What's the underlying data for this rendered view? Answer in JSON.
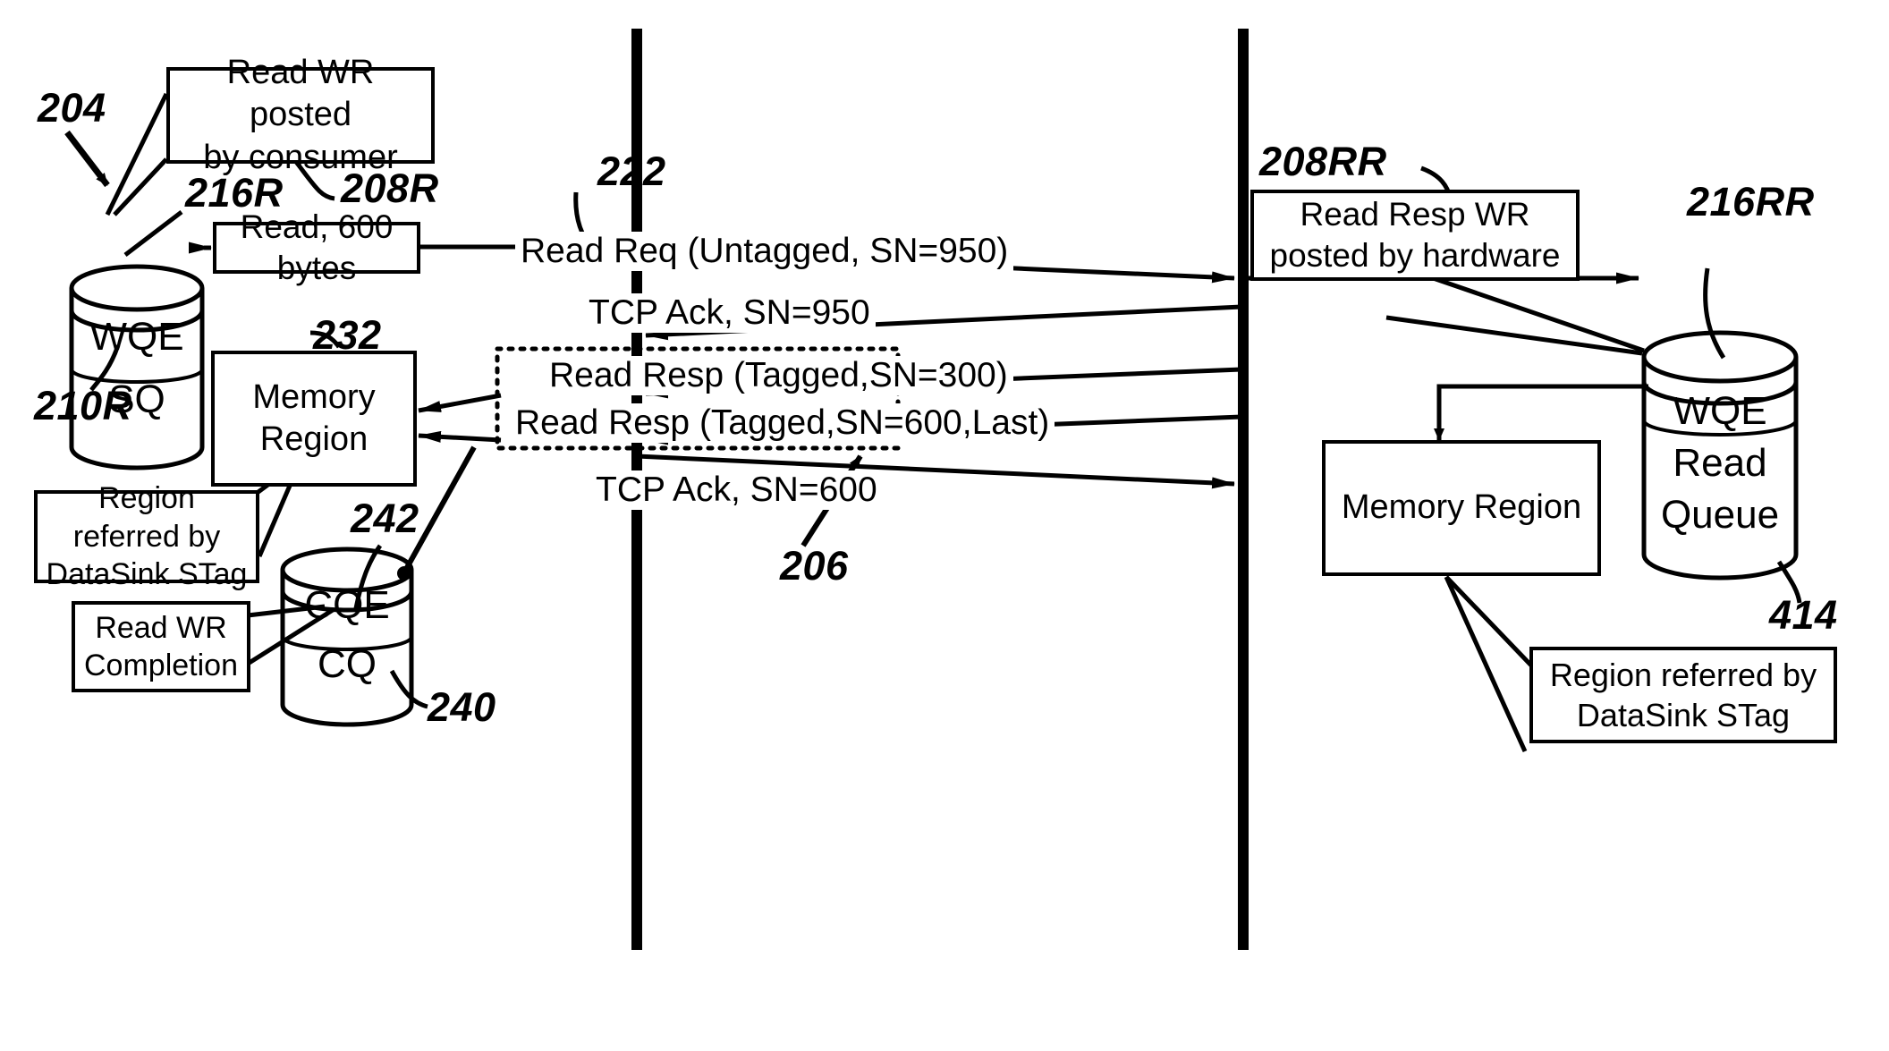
{
  "figure": {
    "type": "rdma-read-operation-sequence-diagram",
    "domain": "patent-figure"
  },
  "reference_numerals": {
    "n204": "204",
    "n216R": "216R",
    "n208R": "208R",
    "n210R": "210R",
    "n232": "232",
    "n242": "242",
    "n240": "240",
    "n222": "222",
    "n206": "206",
    "n208RR": "208RR",
    "n216RR": "216RR",
    "n414": "414"
  },
  "left_side": {
    "sq_cylinder": {
      "top_label": "WQE",
      "bottom_label": "SQ"
    },
    "callout_read_wr": {
      "line1": "Read WR posted",
      "line2": "by consumer"
    },
    "read_op_box": "Read, 600 bytes",
    "memory_region_box": "Memory Region",
    "region_stag_callout": {
      "line1": "Region referred by",
      "line2": "DataSink STag"
    },
    "cq_cylinder": {
      "top_label": "CQE",
      "bottom_label": "CQ"
    },
    "completion_callout": {
      "line1": "Read WR",
      "line2": "Completion"
    }
  },
  "messages": [
    {
      "id": "read-req",
      "text": "Read Req (Untagged, SN=950)",
      "direction": "left-to-right"
    },
    {
      "id": "tcp-ack-950",
      "text": "TCP Ack, SN=950",
      "direction": "right-to-left"
    },
    {
      "id": "read-resp-300",
      "text": "Read Resp (Tagged,SN=300)",
      "direction": "right-to-left"
    },
    {
      "id": "read-resp-600",
      "text": "Read Resp (Tagged,SN=600,Last)",
      "direction": "right-to-left"
    },
    {
      "id": "tcp-ack-600",
      "text": "TCP Ack, SN=600",
      "direction": "left-to-right"
    }
  ],
  "right_side": {
    "callout_read_resp_wr": {
      "line1": "Read Resp WR",
      "line2": "posted by hardware"
    },
    "read_queue_cylinder": {
      "line1": "WQE",
      "line2": "Read",
      "line3": "Queue"
    },
    "memory_region_box": "Memory Region",
    "region_stag_callout": {
      "line1": "Region referred by",
      "line2": "DataSink STag"
    }
  },
  "colors": {
    "ink": "#000000",
    "paper": "#ffffff"
  }
}
